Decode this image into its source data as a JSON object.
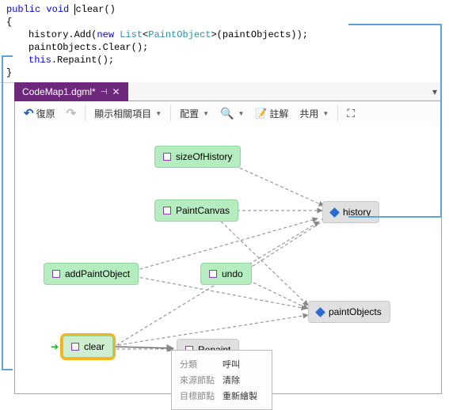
{
  "code": {
    "sig_kw1": "public",
    "sig_kw2": "void",
    "sig_name": "clear",
    "sig_paren": "()",
    "brace_open": "{",
    "brace_close": "}",
    "line1_a": "history.Add(",
    "line1_kw": "new",
    "line1_b": " ",
    "line1_type1": "List",
    "line1_lt": "<",
    "line1_type2": "PaintObject",
    "line1_gt": ">",
    "line1_c": "(paintObjects));",
    "line2": "paintObjects.Clear();",
    "line3_this": "this",
    "line3_rest": ".Repaint();"
  },
  "tab": {
    "label": "CodeMap1.dgml*"
  },
  "toolbar": {
    "undo": "復原",
    "related": "顯示相關項目",
    "layout": "配置",
    "comment": "註解",
    "share": "共用"
  },
  "nodes": {
    "sizeOfHistory": "sizeOfHistory",
    "PaintCanvas": "PaintCanvas",
    "addPaintObject": "addPaintObject",
    "undo": "undo",
    "clear": "clear",
    "Repaint": "Repaint",
    "history": "history",
    "paintObjects": "paintObjects"
  },
  "tooltip": {
    "r1k": "分類",
    "r1v": "呼叫",
    "r2k": "來源節點",
    "r2v": "清除",
    "r3k": "目標節點",
    "r3v": "重新繪製"
  }
}
